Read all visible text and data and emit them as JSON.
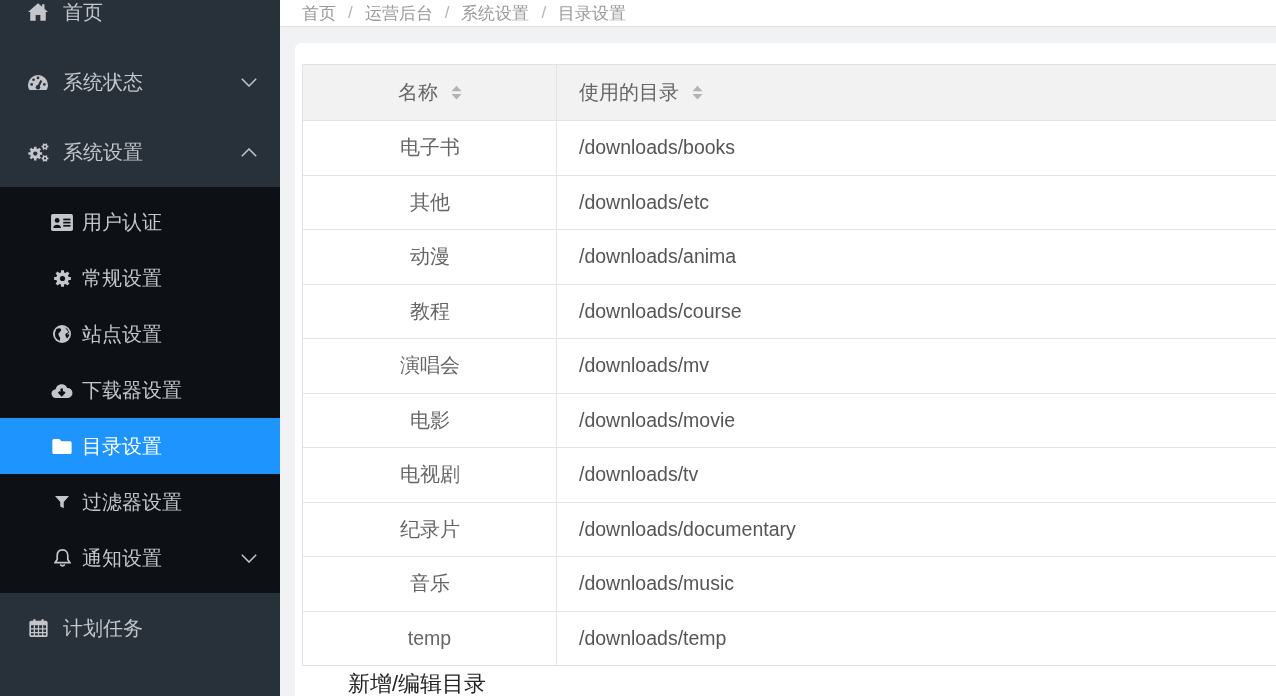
{
  "sidebar": {
    "items": [
      {
        "label": "首页",
        "kind": "link",
        "selected": false
      },
      {
        "label": "系统状态",
        "kind": "group",
        "expanded": false,
        "selected": false
      },
      {
        "label": "系统设置",
        "kind": "group",
        "expanded": true,
        "selected": false,
        "children": [
          {
            "label": "用户认证",
            "kind": "link",
            "selected": false
          },
          {
            "label": "常规设置",
            "kind": "link",
            "selected": false
          },
          {
            "label": "站点设置",
            "kind": "link",
            "selected": false
          },
          {
            "label": "下载器设置",
            "kind": "link",
            "selected": false
          },
          {
            "label": "目录设置",
            "kind": "link",
            "selected": true
          },
          {
            "label": "过滤器设置",
            "kind": "link",
            "selected": false
          },
          {
            "label": "通知设置",
            "kind": "group",
            "expanded": false,
            "selected": false
          }
        ]
      },
      {
        "label": "计划任务",
        "kind": "link",
        "selected": false
      }
    ]
  },
  "breadcrumb": [
    {
      "kind": "link",
      "text": "首页"
    },
    {
      "kind": "separator",
      "text": "/"
    },
    {
      "kind": "link",
      "text": "运营后台"
    },
    {
      "kind": "separator",
      "text": "/"
    },
    {
      "kind": "link",
      "text": "系统设置"
    },
    {
      "kind": "separator",
      "text": "/"
    },
    {
      "kind": "link",
      "text": "目录设置"
    }
  ],
  "table": {
    "columns": [
      {
        "label": "名称"
      },
      {
        "label": "使用的目录"
      }
    ],
    "rows": [
      {
        "name": "电子书",
        "directory": "/downloads/books"
      },
      {
        "name": "其他",
        "directory": "/downloads/etc"
      },
      {
        "name": "动漫",
        "directory": "/downloads/anima"
      },
      {
        "name": "教程",
        "directory": "/downloads/course"
      },
      {
        "name": "演唱会",
        "directory": "/downloads/mv"
      },
      {
        "name": "电影",
        "directory": "/downloads/movie"
      },
      {
        "name": "电视剧",
        "directory": "/downloads/tv"
      },
      {
        "name": "纪录片",
        "directory": "/downloads/documentary"
      },
      {
        "name": "音乐",
        "directory": "/downloads/music"
      },
      {
        "name": "temp",
        "directory": "/downloads/temp"
      }
    ]
  },
  "edit_section": {
    "title": "新增/编辑目录"
  }
}
